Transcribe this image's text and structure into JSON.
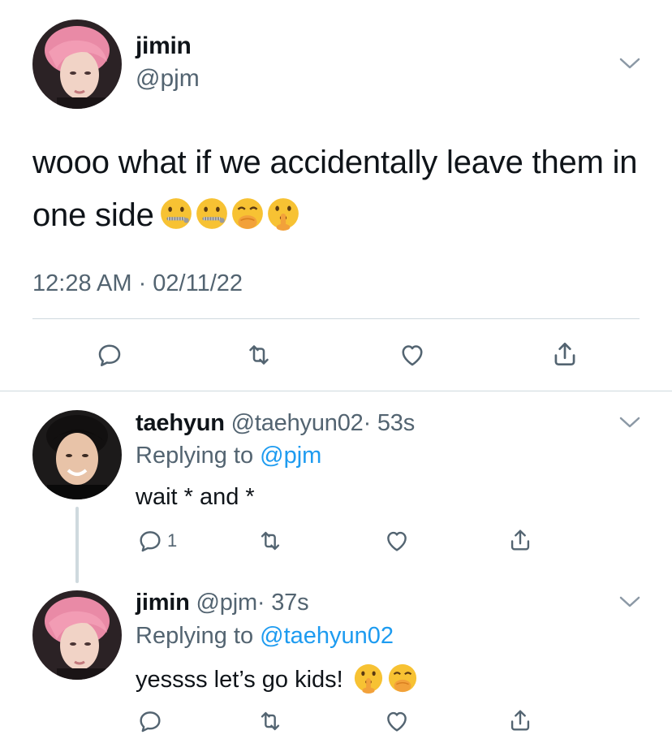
{
  "main_tweet": {
    "name": "jimin",
    "handle": "@pjm",
    "text": "wooo what if we accidentally leave them in one side",
    "emojis": [
      "zipper-mouth-face",
      "zipper-mouth-face",
      "face-with-hand-over-mouth",
      "shushing-face"
    ],
    "timestamp": "12:28 AM · 02/11/22"
  },
  "replies": [
    {
      "name": "taehyun",
      "handle": "@taehyun02",
      "time": "· 53s",
      "replying_prefix": "Replying to ",
      "replying_to": "@pjm",
      "text": "wait * and *",
      "reply_count": "1"
    },
    {
      "name": "jimin",
      "handle": "@pjm",
      "time": "· 37s",
      "replying_prefix": "Replying to ",
      "replying_to": "@taehyun02",
      "text": "yessss let’s go kids!",
      "emojis": [
        "shushing-face",
        "face-with-hand-over-mouth"
      ]
    }
  ],
  "icons": [
    "reply-icon",
    "retweet-icon",
    "like-icon",
    "share-icon",
    "chevron-down-icon"
  ],
  "colors": {
    "text": "#0f1419",
    "secondary": "#536471",
    "link": "#1d9bf0",
    "divider": "#cfd9de"
  }
}
